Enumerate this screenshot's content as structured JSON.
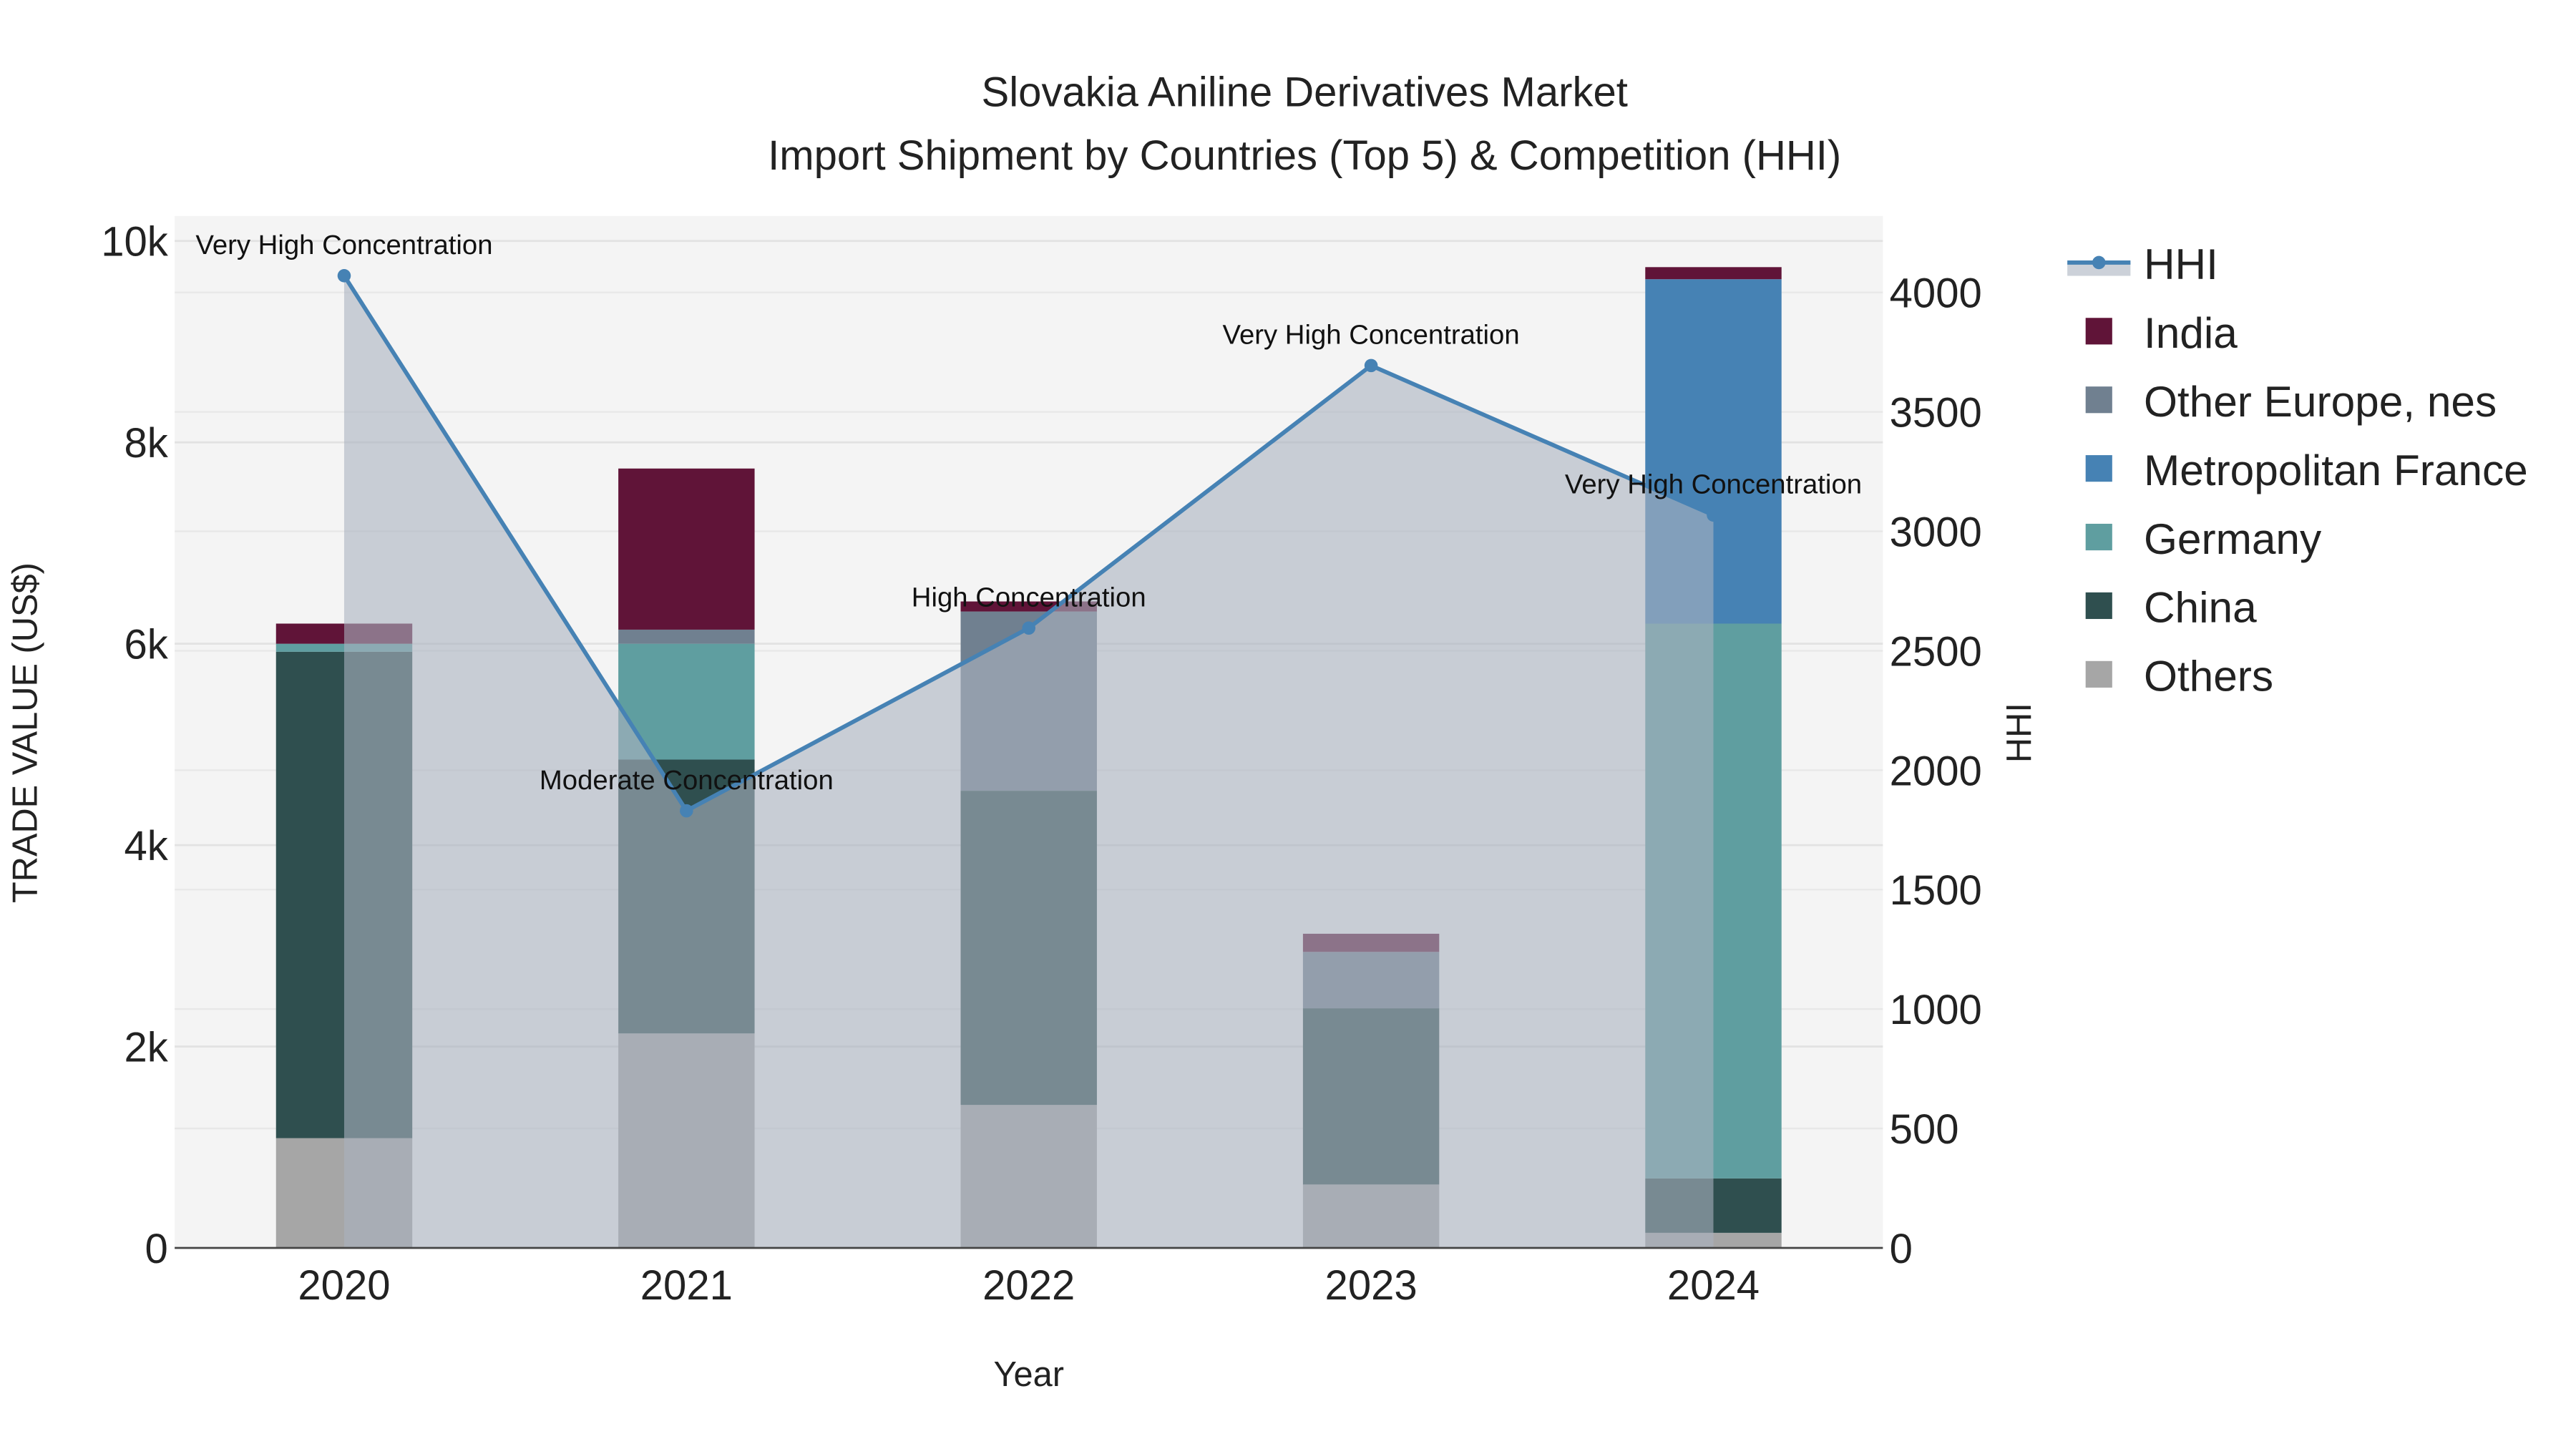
{
  "chart_data": {
    "type": "bar",
    "title": "Slovakia Aniline Derivatives Market",
    "subtitle": "Import Shipment by Countries (Top 5) & Competition (HHI)",
    "xlabel": "Year",
    "ylabel": "TRADE VALUE (US$)",
    "y2label": "HHI",
    "categories": [
      "2020",
      "2021",
      "2022",
      "2023",
      "2024"
    ],
    "ylim": [
      0,
      10000
    ],
    "y2lim": [
      0,
      4300
    ],
    "yticks": [
      {
        "v": 0,
        "label": "0"
      },
      {
        "v": 2000,
        "label": "2k"
      },
      {
        "v": 4000,
        "label": "4k"
      },
      {
        "v": 6000,
        "label": "6k"
      },
      {
        "v": 8000,
        "label": "8k"
      },
      {
        "v": 10000,
        "label": "10k"
      }
    ],
    "y2ticks": [
      0,
      500,
      1000,
      1500,
      2000,
      2500,
      3000,
      3500,
      4000
    ],
    "series": [
      {
        "name": "Others",
        "color": "#a6a6a6",
        "values": [
          1090,
          2130,
          1420,
          630,
          150
        ]
      },
      {
        "name": "China",
        "color": "#2f4f4f",
        "values": [
          4830,
          2720,
          3120,
          1750,
          540
        ]
      },
      {
        "name": "Germany",
        "color": "#5f9ea0",
        "values": [
          80,
          1150,
          0,
          0,
          5510
        ]
      },
      {
        "name": "Metropolitan France",
        "color": "#4682b4",
        "values": [
          0,
          0,
          0,
          0,
          3420
        ]
      },
      {
        "name": "Other Europe, nes",
        "color": "#708090",
        "values": [
          0,
          140,
          1780,
          560,
          0
        ]
      },
      {
        "name": "India",
        "color": "#601438",
        "values": [
          200,
          1600,
          100,
          180,
          120
        ]
      }
    ],
    "legend_order": [
      "HHI",
      "India",
      "Other Europe, nes",
      "Metropolitan France",
      "Germany",
      "China",
      "Others"
    ],
    "legend_position": "right",
    "hhi": {
      "name": "HHI",
      "color": "#4682b4",
      "values": [
        4070,
        1830,
        2595,
        3694,
        3068
      ],
      "annotations": [
        "Very High Concentration",
        "Moderate Concentration",
        "High Concentration",
        "Very High Concentration",
        "Very High Concentration"
      ]
    }
  }
}
